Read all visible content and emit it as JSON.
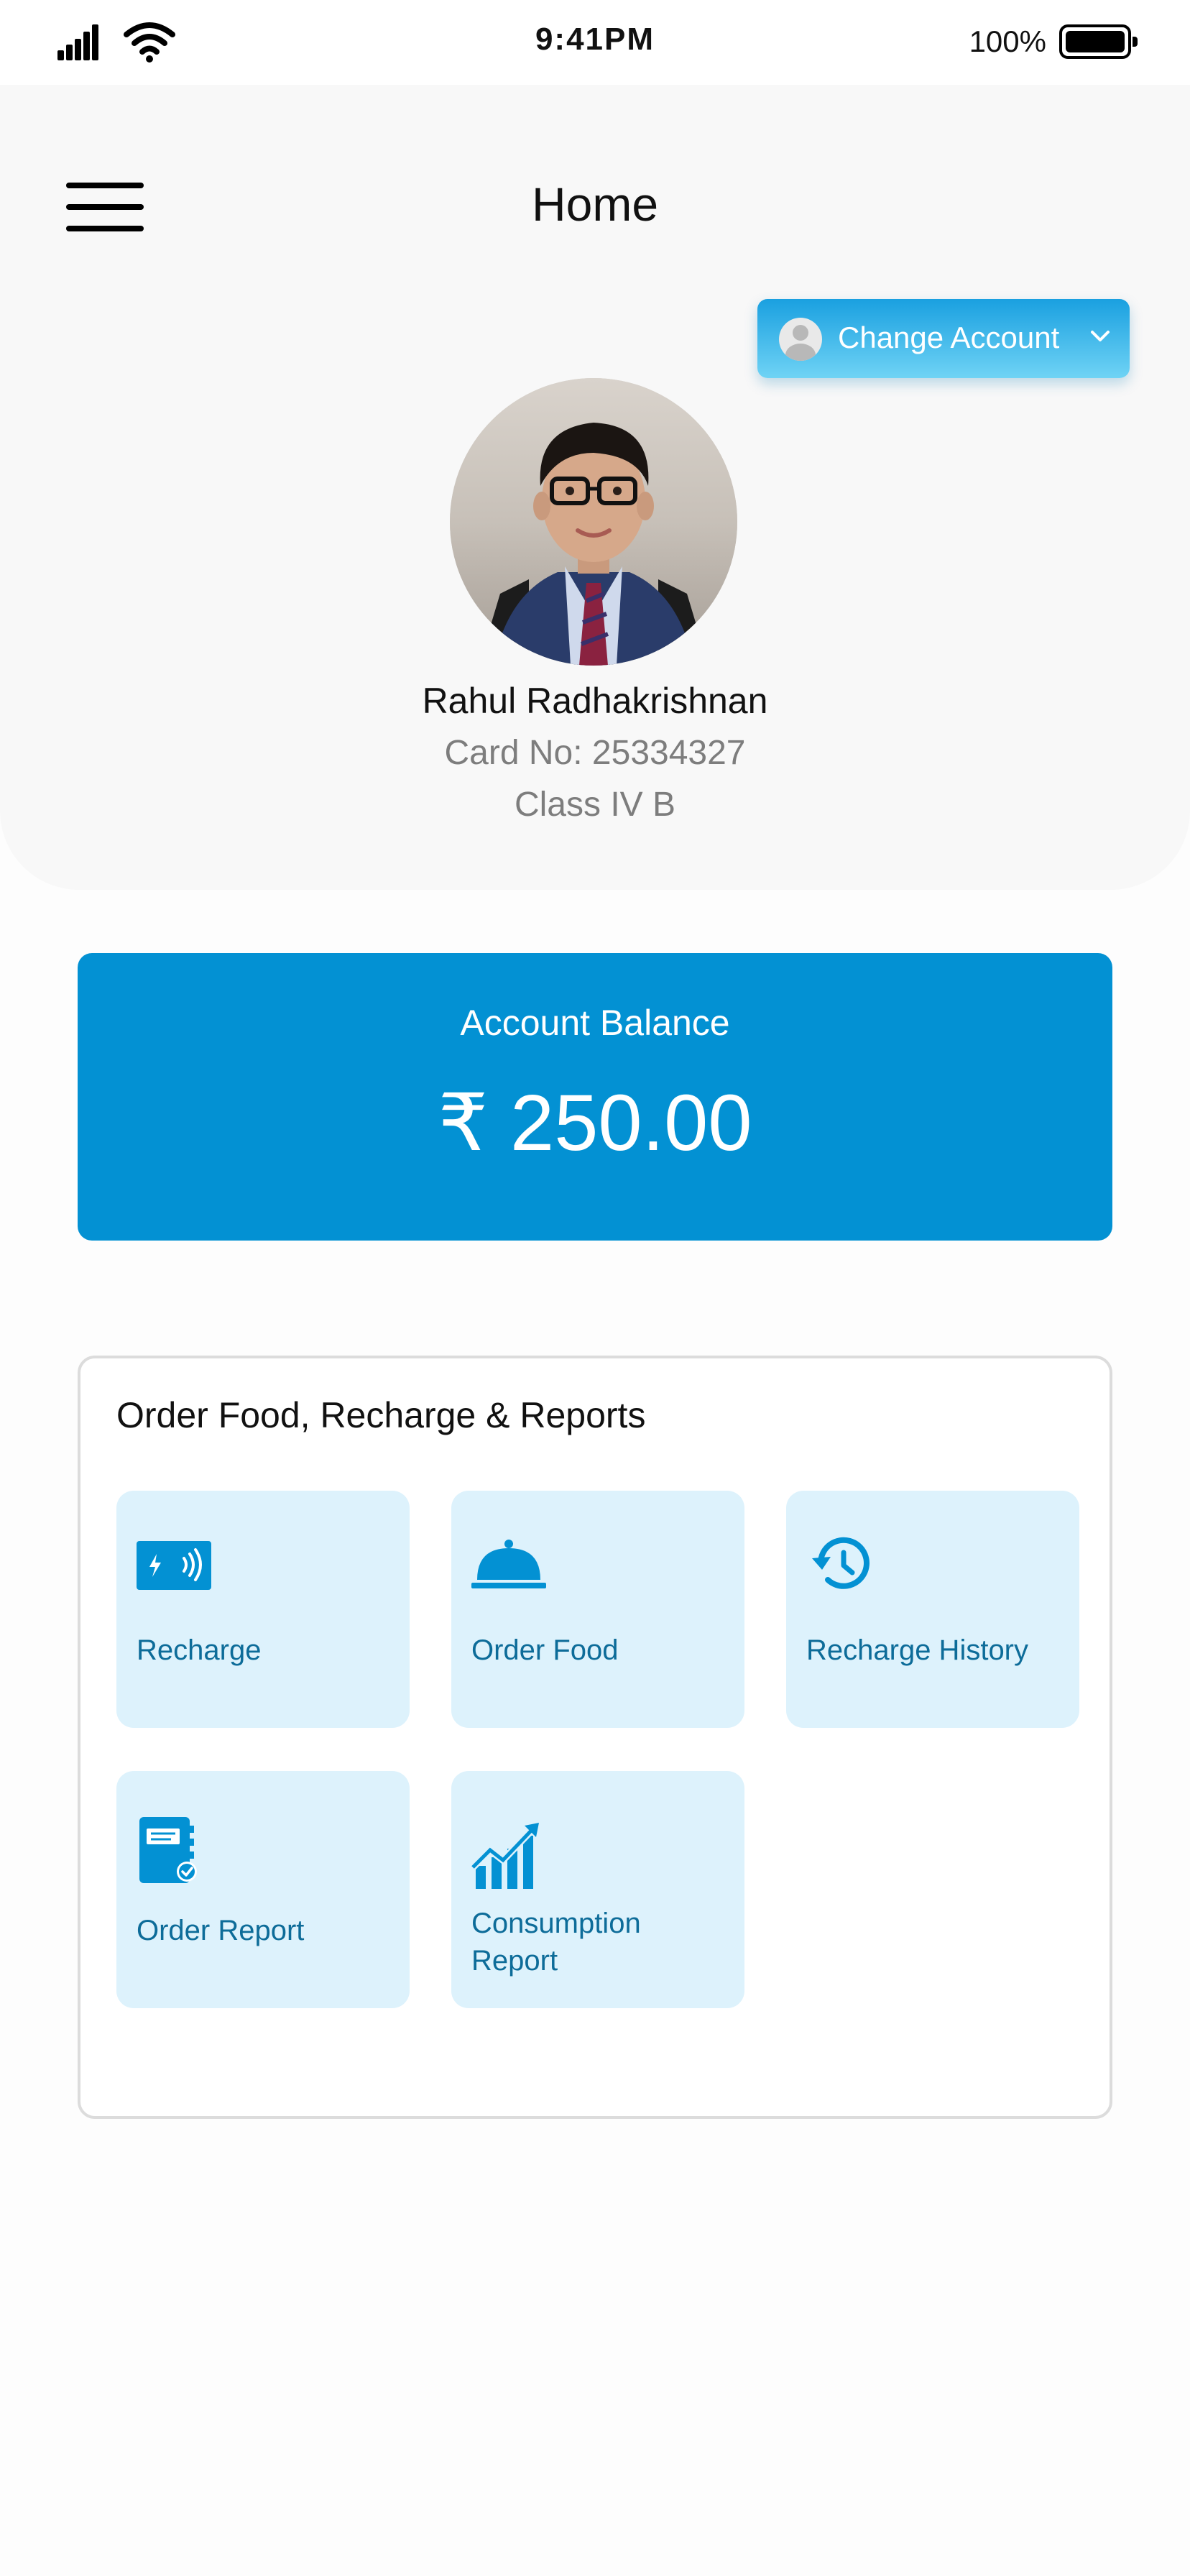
{
  "status_bar": {
    "time": "9:41PM",
    "battery_percent": "100%"
  },
  "header": {
    "title": "Home"
  },
  "account_switcher": {
    "label": "Change Account"
  },
  "profile": {
    "name": "Rahul Radhakrishnan",
    "card_no": "Card No: 25334327",
    "class": "Class IV B"
  },
  "balance": {
    "label": "Account Balance",
    "value": "₹ 250.00"
  },
  "services": {
    "title": "Order Food, Recharge & Reports",
    "tiles": [
      {
        "label": "Recharge",
        "icon": "wallet-charge-icon"
      },
      {
        "label": "Order Food",
        "icon": "food-cloche-icon"
      },
      {
        "label": "Recharge History",
        "icon": "history-clock-icon"
      },
      {
        "label": "Order Report",
        "icon": "report-notebook-icon"
      },
      {
        "label": "Consumption Report",
        "icon": "growth-chart-icon"
      }
    ]
  },
  "colors": {
    "accent": "#0391d3",
    "tile_bg": "#ddf2fc",
    "tile_text": "#0d6c99"
  }
}
